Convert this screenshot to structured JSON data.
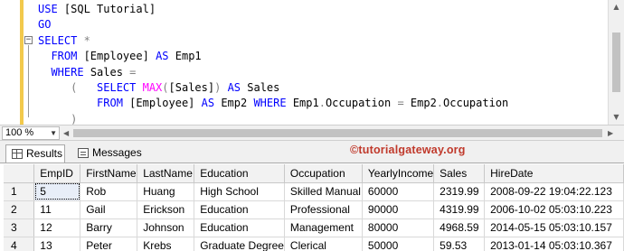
{
  "editor": {
    "lines": [
      [
        [
          "kw",
          "USE "
        ],
        [
          "txt",
          "[SQL Tutorial]"
        ]
      ],
      [
        [
          "kw",
          "GO"
        ]
      ],
      [
        [
          "kw",
          "SELECT "
        ],
        [
          "gr",
          "*"
        ]
      ],
      [
        [
          "txt",
          "  "
        ],
        [
          "kw",
          "FROM "
        ],
        [
          "txt",
          "[Employee] "
        ],
        [
          "kw",
          "AS "
        ],
        [
          "txt",
          "Emp1"
        ]
      ],
      [
        [
          "txt",
          "  "
        ],
        [
          "kw",
          "WHERE "
        ],
        [
          "txt",
          "Sales "
        ],
        [
          "gr",
          "="
        ]
      ],
      [
        [
          "txt",
          "     "
        ],
        [
          "gr",
          "(   "
        ],
        [
          "kw",
          "SELECT "
        ],
        [
          "fn",
          "MAX"
        ],
        [
          "gr",
          "("
        ],
        [
          "txt",
          "[Sales]"
        ],
        [
          "gr",
          ") "
        ],
        [
          "kw",
          "AS "
        ],
        [
          "txt",
          "Sales"
        ]
      ],
      [
        [
          "txt",
          "         "
        ],
        [
          "kw",
          "FROM "
        ],
        [
          "txt",
          "[Employee] "
        ],
        [
          "kw",
          "AS "
        ],
        [
          "txt",
          "Emp2 "
        ],
        [
          "kw",
          "WHERE "
        ],
        [
          "txt",
          "Emp1"
        ],
        [
          "gr",
          "."
        ],
        [
          "txt",
          "Occupation "
        ],
        [
          "gr",
          "= "
        ],
        [
          "txt",
          "Emp2"
        ],
        [
          "gr",
          "."
        ],
        [
          "txt",
          "Occupation"
        ]
      ],
      [
        [
          "txt",
          "     "
        ],
        [
          "gr",
          ")"
        ]
      ]
    ]
  },
  "zoom": {
    "value": "100 %"
  },
  "tabs": {
    "results_label": "Results",
    "messages_label": "Messages"
  },
  "watermark": "©tutorialgateway.org",
  "colors": {
    "keyword": "#0000ff",
    "function": "#ff00ff",
    "operator": "#808080",
    "watermark": "#c0392b"
  },
  "results": {
    "columns": [
      "EmpID",
      "FirstName",
      "LastName",
      "Education",
      "Occupation",
      "YearlyIncome",
      "Sales",
      "HireDate"
    ],
    "rows": [
      [
        "1",
        "5",
        "Rob",
        "Huang",
        "High School",
        "Skilled Manual",
        "60000",
        "2319.99",
        "2008-09-22 19:04:22.123"
      ],
      [
        "2",
        "11",
        "Gail",
        "Erickson",
        "Education",
        "Professional",
        "90000",
        "4319.99",
        "2006-10-02 05:03:10.223"
      ],
      [
        "3",
        "12",
        "Barry",
        "Johnson",
        "Education",
        "Management",
        "80000",
        "4968.59",
        "2014-05-15 05:03:10.157"
      ],
      [
        "4",
        "13",
        "Peter",
        "Krebs",
        "Graduate Degree",
        "Clerical",
        "50000",
        "59.53",
        "2013-01-14 05:03:10.367"
      ]
    ]
  }
}
